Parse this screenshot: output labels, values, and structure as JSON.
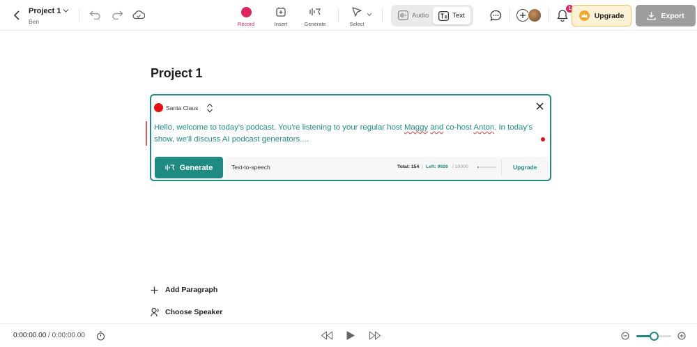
{
  "header": {
    "project_name": "Project 1",
    "owner": "Ben",
    "tools": {
      "record": "Record",
      "insert": "Insert",
      "generate": "Generate",
      "select": "Select"
    },
    "mode_audio": "Audio",
    "mode_text": "Text",
    "notification_count": "1",
    "upgrade_label": "Upgrade",
    "export_label": "Export",
    "colors": {
      "record": "#e0245e",
      "upgrade_bg": "#fdf1d6",
      "upgrade_border": "#f0c060",
      "export_bg": "#9e9e9e"
    }
  },
  "main": {
    "title": "Project 1",
    "paragraph": {
      "speaker": "Santa Claus",
      "text_part1": "Hello, welcome to today's podcast. You're listening to your regular host ",
      "name_host": "Maggy",
      "text_part2": " ",
      "word_and": "and",
      "text_part3": " co-host ",
      "name_cohost": "Anton",
      "text_part4": ". In today's show, we'll discuss AI podcast generators....",
      "generate_label": "Generate",
      "tts_label": "Text-to-speech",
      "total_label": "Total: 154",
      "left_label": "Left: 9926",
      "limit_label": "/ 10000",
      "usage_fraction": 0.015,
      "upgrade_link": "Upgrade",
      "accent_color": "#1e8c84"
    },
    "add_paragraph": "Add Paragraph",
    "choose_speaker": "Choose Speaker"
  },
  "footer": {
    "time_current": "0:00:00.00",
    "time_sep": " / ",
    "time_total": "0:00:00.00",
    "zoom_level": 0.5
  }
}
